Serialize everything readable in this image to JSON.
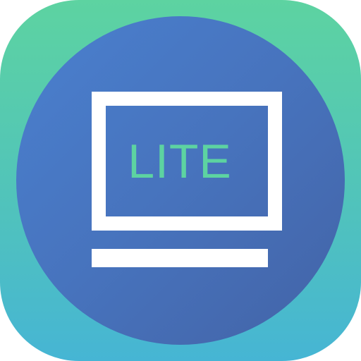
{
  "icon": {
    "label": "LITE",
    "colors": {
      "background_top": "#5dd3a1",
      "background_bottom": "#46b5d4",
      "circle_top": "#4a80cf",
      "circle_bottom": "#4363a6",
      "monitor": "#ffffff",
      "label": "#5dd3a1"
    },
    "glyph": "monitor-icon"
  }
}
